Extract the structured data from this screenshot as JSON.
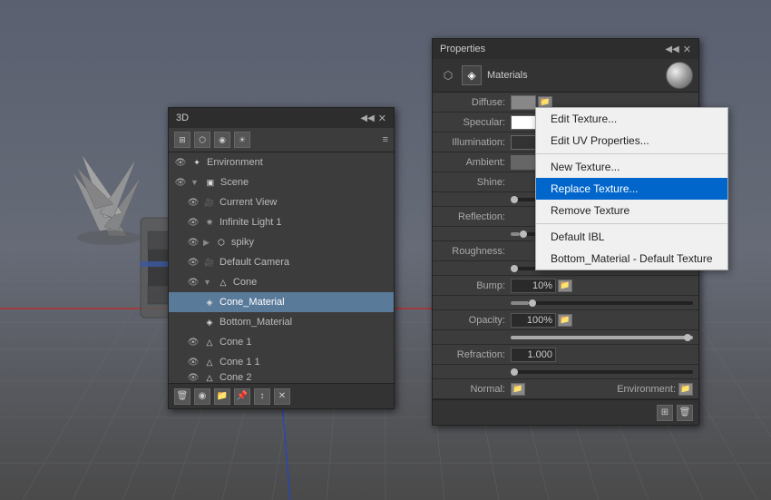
{
  "viewport": {
    "background": "#555555"
  },
  "panel3d": {
    "title": "3D",
    "toolbar_icons": [
      "grid-icon",
      "mesh-icon",
      "light-icon",
      "camera-icon"
    ],
    "layers": [
      {
        "id": "environment",
        "label": "Environment",
        "indent": 0,
        "icon": "sun-icon",
        "visible": true,
        "expanded": true
      },
      {
        "id": "scene",
        "label": "Scene",
        "indent": 0,
        "icon": "scene-icon",
        "visible": true,
        "expanded": true
      },
      {
        "id": "current-view",
        "label": "Current View",
        "indent": 1,
        "icon": "camera-icon",
        "visible": true
      },
      {
        "id": "infinite-light",
        "label": "Infinite Light 1",
        "indent": 1,
        "icon": "light-icon",
        "visible": true
      },
      {
        "id": "spiky",
        "label": "spiky",
        "indent": 1,
        "icon": "mesh-icon",
        "visible": true,
        "expanded": false
      },
      {
        "id": "default-camera",
        "label": "Default Camera",
        "indent": 1,
        "icon": "camera-icon",
        "visible": true
      },
      {
        "id": "cone",
        "label": "Cone",
        "indent": 1,
        "icon": "cone-icon",
        "visible": true,
        "expanded": true
      },
      {
        "id": "cone-material",
        "label": "Cone_Material",
        "indent": 2,
        "icon": "material-icon",
        "visible": false,
        "selected": true
      },
      {
        "id": "bottom-material",
        "label": "Bottom_Material",
        "indent": 2,
        "icon": "material-icon",
        "visible": false
      },
      {
        "id": "cone1",
        "label": "Cone 1",
        "indent": 1,
        "icon": "cone-icon",
        "visible": true
      },
      {
        "id": "cone11",
        "label": "Cone 1 1",
        "indent": 1,
        "icon": "cone-icon",
        "visible": true
      },
      {
        "id": "cone2",
        "label": "Cone 2",
        "indent": 1,
        "icon": "cone-icon",
        "visible": true
      }
    ],
    "footer_icons": [
      "trash-icon",
      "sphere-icon",
      "folder-icon",
      "pin-icon",
      "arrow-icon",
      "delete-icon"
    ]
  },
  "properties_panel": {
    "title": "Properties",
    "tab": "Materials",
    "material_properties": [
      {
        "label": "Diffuse:",
        "type": "swatch-folder",
        "color": "#888888"
      },
      {
        "label": "Specular:",
        "type": "swatch-folder",
        "color": "#ffffff"
      },
      {
        "label": "Illumination:",
        "type": "swatch-folder",
        "color": "#333333"
      },
      {
        "label": "Ambient:",
        "type": "swatch-folder",
        "color": "#666666"
      }
    ],
    "shine": {
      "label": "Shine:",
      "value": 0,
      "percent": 0
    },
    "reflection": {
      "label": "Reflection:",
      "value": 0,
      "percent": 5
    },
    "roughness": {
      "label": "Roughness:",
      "value": 0,
      "percent": 0
    },
    "bump": {
      "label": "Bump:",
      "value": "10%",
      "percent": 10
    },
    "opacity": {
      "label": "Opacity:",
      "value": "100%",
      "percent": 100
    },
    "refraction": {
      "label": "Refraction:",
      "value": "1.000",
      "percent": 0
    },
    "normal_label": "Normal:",
    "environment_label": "Environment:",
    "footer_icons": [
      "trash-icon",
      "new-icon"
    ]
  },
  "context_menu": {
    "items": [
      {
        "id": "edit-texture",
        "label": "Edit Texture...",
        "enabled": true
      },
      {
        "id": "edit-uv",
        "label": "Edit UV Properties...",
        "enabled": true
      },
      {
        "separator": true
      },
      {
        "id": "new-texture",
        "label": "New Texture...",
        "enabled": true
      },
      {
        "id": "replace-texture",
        "label": "Replace Texture...",
        "enabled": true,
        "highlighted": true
      },
      {
        "id": "remove-texture",
        "label": "Remove Texture",
        "enabled": true
      },
      {
        "separator": true
      },
      {
        "id": "default-ibl",
        "label": "Default IBL",
        "enabled": true
      },
      {
        "id": "bottom-material-default",
        "label": "Bottom_Material - Default Texture",
        "enabled": true
      }
    ]
  }
}
